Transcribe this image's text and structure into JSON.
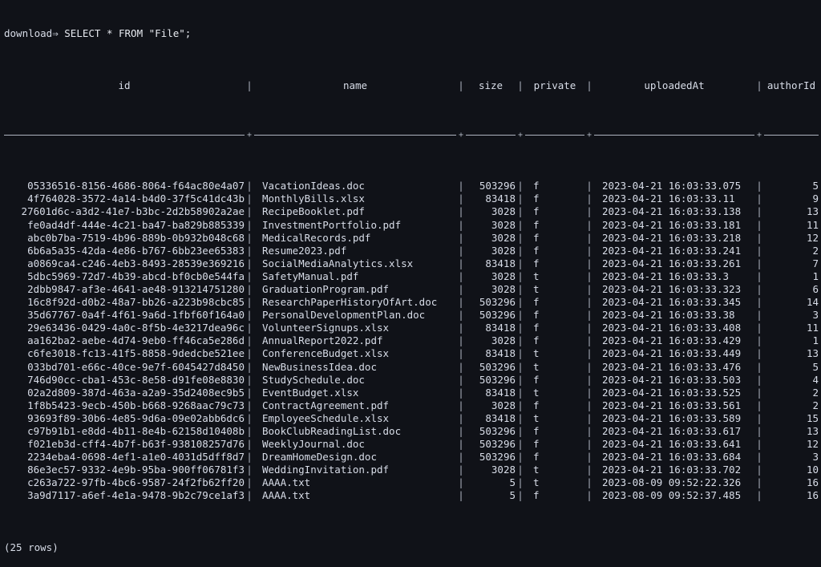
{
  "terminal": {
    "prompt": "download⇒",
    "command": "SELECT * FROM \"File\";",
    "footer": "(25 rows)"
  },
  "table": {
    "columns": [
      "id",
      "name",
      "size",
      "private",
      "uploadedAt",
      "authorId"
    ],
    "rows": [
      [
        "05336516-8156-4686-8064-f64ac80e4a07",
        "VacationIdeas.doc",
        "503296",
        "f",
        "2023-04-21 16:03:33.075",
        "5"
      ],
      [
        "4f764028-3572-4a14-b4d0-37f5c41dc43b",
        "MonthlyBills.xlsx",
        "83418",
        "f",
        "2023-04-21 16:03:33.11",
        "9"
      ],
      [
        "27601d6c-a3d2-41e7-b3bc-2d2b58902a2ae",
        "RecipeBooklet.pdf",
        "3028",
        "f",
        "2023-04-21 16:03:33.138",
        "13"
      ],
      [
        "fe0ad4df-444e-4c21-ba47-ba829b885339",
        "InvestmentPortfolio.pdf",
        "3028",
        "f",
        "2023-04-21 16:03:33.181",
        "11"
      ],
      [
        "abc0b7ba-7519-4b96-889b-0b932b048c68",
        "MedicalRecords.pdf",
        "3028",
        "f",
        "2023-04-21 16:03:33.218",
        "12"
      ],
      [
        "6b6a5a35-42da-4e86-b767-6bb23ee65383",
        "Resume2023.pdf",
        "3028",
        "f",
        "2023-04-21 16:03:33.241",
        "2"
      ],
      [
        "a0869ca4-c246-4eb3-8493-28539e369216",
        "SocialMediaAnalytics.xlsx",
        "83418",
        "f",
        "2023-04-21 16:03:33.261",
        "7"
      ],
      [
        "5dbc5969-72d7-4b39-abcd-bf0cb0e544fa",
        "SafetyManual.pdf",
        "3028",
        "t",
        "2023-04-21 16:03:33.3",
        "1"
      ],
      [
        "2dbb9847-af3e-4641-ae48-913214751280",
        "GraduationProgram.pdf",
        "3028",
        "t",
        "2023-04-21 16:03:33.323",
        "6"
      ],
      [
        "16c8f92d-d0b2-48a7-bb26-a223b98cbc85",
        "ResearchPaperHistoryOfArt.doc",
        "503296",
        "f",
        "2023-04-21 16:03:33.345",
        "14"
      ],
      [
        "35d67767-0a4f-4f61-9a6d-1fbf60f164a0",
        "PersonalDevelopmentPlan.doc",
        "503296",
        "f",
        "2023-04-21 16:03:33.38",
        "3"
      ],
      [
        "29e63436-0429-4a0c-8f5b-4e3217dea96c",
        "VolunteerSignups.xlsx",
        "83418",
        "f",
        "2023-04-21 16:03:33.408",
        "11"
      ],
      [
        "aa162ba2-aebe-4d74-9eb0-ff46ca5e286d",
        "AnnualReport2022.pdf",
        "3028",
        "f",
        "2023-04-21 16:03:33.429",
        "1"
      ],
      [
        "c6fe3018-fc13-41f5-8858-9dedcbe521ee",
        "ConferenceBudget.xlsx",
        "83418",
        "t",
        "2023-04-21 16:03:33.449",
        "13"
      ],
      [
        "033bd701-e66c-40ce-9e7f-6045427d8450",
        "NewBusinessIdea.doc",
        "503296",
        "t",
        "2023-04-21 16:03:33.476",
        "5"
      ],
      [
        "746d90cc-cba1-453c-8e58-d91fe08e8830",
        "StudySchedule.doc",
        "503296",
        "f",
        "2023-04-21 16:03:33.503",
        "4"
      ],
      [
        "02a2d809-387d-463a-a2a9-35d2408ec9b5",
        "EventBudget.xlsx",
        "83418",
        "t",
        "2023-04-21 16:03:33.525",
        "2"
      ],
      [
        "1f8b5423-9ecb-450b-b668-9268aac79c73",
        "ContractAgreement.pdf",
        "3028",
        "f",
        "2023-04-21 16:03:33.561",
        "2"
      ],
      [
        "93693f89-30b6-4e85-9d6a-09e02abb6dc6",
        "EmployeeSchedule.xlsx",
        "83418",
        "t",
        "2023-04-21 16:03:33.589",
        "15"
      ],
      [
        "c97b91b1-e8dd-4b11-8e4b-62158d10408b",
        "BookClubReadingList.doc",
        "503296",
        "f",
        "2023-04-21 16:03:33.617",
        "13"
      ],
      [
        "f021eb3d-cff4-4b7f-b63f-938108257d76",
        "WeeklyJournal.doc",
        "503296",
        "f",
        "2023-04-21 16:03:33.641",
        "12"
      ],
      [
        "2234eba4-0698-4ef1-a1e0-4031d5dff8d7",
        "DreamHomeDesign.doc",
        "503296",
        "f",
        "2023-04-21 16:03:33.684",
        "3"
      ],
      [
        "86e3ec57-9332-4e9b-95ba-900ff06781f3",
        "WeddingInvitation.pdf",
        "3028",
        "t",
        "2023-04-21 16:03:33.702",
        "10"
      ],
      [
        "c263a722-97fb-4bc6-9587-24f2fb62ff20",
        "AAAA.txt",
        "5",
        "t",
        "2023-08-09 09:52:22.326",
        "16"
      ],
      [
        "3a9d7117-a6ef-4e1a-9478-9b2c79ce1af3",
        "AAAA.txt",
        "5",
        "f",
        "2023-08-09 09:52:37.485",
        "16"
      ]
    ]
  }
}
